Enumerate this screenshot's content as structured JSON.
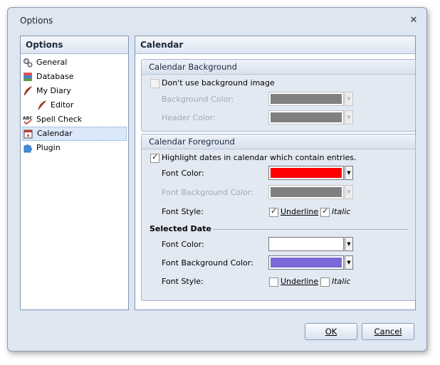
{
  "window": {
    "title": "Options",
    "close_glyph": "✕"
  },
  "left": {
    "header": "Options",
    "items": [
      {
        "label": "General",
        "icon": "gears-icon"
      },
      {
        "label": "Database",
        "icon": "database-icon"
      },
      {
        "label": "My Diary",
        "icon": "quill-icon"
      },
      {
        "label": "Editor",
        "icon": "quill-icon"
      },
      {
        "label": "Spell Check",
        "icon": "abc-spellcheck-icon"
      },
      {
        "label": "Calendar",
        "icon": "calendar-icon",
        "selected": true
      },
      {
        "label": "Plugin",
        "icon": "puzzle-icon"
      }
    ]
  },
  "right": {
    "header": "Calendar",
    "background_group": {
      "title": "Calendar Background",
      "no_bg_label": "Don't use background image",
      "bg_color_label": "Background Color:",
      "bg_color": "#808080",
      "header_color_label": "Header Color:",
      "header_color": "#808080"
    },
    "foreground_group": {
      "title": "Calendar Foreground",
      "highlight_label": "Highlight dates in calendar which contain entries.",
      "font_color_label": "Font Color:",
      "font_color": "#ff0000",
      "font_bg_label": "Font Background Color:",
      "font_bg_color": "#808080",
      "font_style_label": "Font Style:",
      "underline_label": "Underline",
      "italic_label": "Italic",
      "selected_date_label": "Selected Date",
      "sel_font_color_label": "Font Color:",
      "sel_font_color": "#ffffff",
      "sel_font_bg_label": "Font Background Color:",
      "sel_font_bg_color": "#7b68d9",
      "sel_font_style_label": "Font Style:",
      "sel_underline_label": "Underline",
      "sel_italic_label": "Italic"
    }
  },
  "buttons": {
    "ok": "OK",
    "cancel": "Cancel"
  }
}
